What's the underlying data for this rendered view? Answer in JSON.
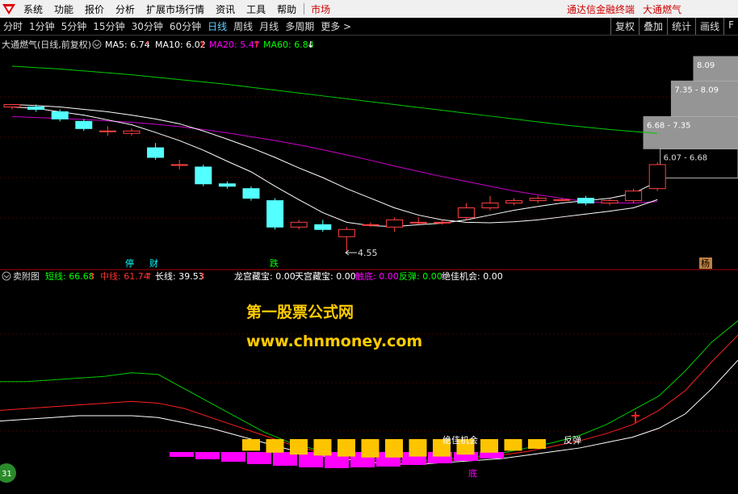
{
  "menu": {
    "items": [
      "系统",
      "功能",
      "报价",
      "分析",
      "扩展市场行情",
      "资讯",
      "工具",
      "帮助"
    ],
    "market": "市场",
    "brand": "通达信金融终端",
    "stock": "大通燃气"
  },
  "periods": [
    "分时",
    "1分钟",
    "5分钟",
    "15分钟",
    "30分钟",
    "60分钟",
    "日线",
    "周线",
    "月线",
    "多周期",
    "更多 >"
  ],
  "active_period": "日线",
  "toolbar_right": [
    "复权",
    "叠加",
    "统计",
    "画线",
    "F"
  ],
  "main_panel": {
    "title": "大通燃气(日线,前复权)",
    "ma": [
      {
        "label": "MA5: 6.74",
        "arrow": "↑",
        "color": "#ffffff"
      },
      {
        "label": "MA10: 6.02",
        "arrow": "↑",
        "color": "#ffffff"
      },
      {
        "label": "MA20: 5.47",
        "arrow": "↑",
        "color": "#ff00ff"
      },
      {
        "label": "MA60: 6.84",
        "arrow": "↓",
        "color": "#00ff00"
      }
    ],
    "low_label": "4.55",
    "price_ranges": [
      "8.09",
      "7.35 - 8.09",
      "6.68 - 7.35",
      "6.07 - 6.68"
    ],
    "markers": [
      "停",
      "财",
      "跌",
      "杨"
    ]
  },
  "sub_panel": {
    "title": "卖附图",
    "fields": [
      {
        "label": "短线: 66.68",
        "arrow": "↑",
        "color": "#00ff00"
      },
      {
        "label": "中线: 61.74",
        "arrow": "↑",
        "color": "#ff3030"
      },
      {
        "label": "长线: 39.53",
        "arrow": "↑",
        "color": "#ffffff"
      },
      {
        "label": "龙宫藏宝: 0.00",
        "arrow": "",
        "color": "#ffffff"
      },
      {
        "label": "天宫藏宝: 0.00",
        "arrow": "",
        "color": "#ffffff"
      },
      {
        "label": "触底: 0.00",
        "arrow": "",
        "color": "#ff00ff"
      },
      {
        "label": "反弹: 0.00",
        "arrow": "",
        "color": "#00ff00"
      },
      {
        "label": "绝佳机会: 0.00",
        "arrow": "",
        "color": "#ffffff"
      }
    ],
    "watermark1": "第一股票公式网",
    "watermark2": "www.chnmoney.com",
    "label_chance": "绝佳机会",
    "label_rebound": "反弹",
    "label_bottom": "底",
    "badge": "31"
  },
  "chart_data": {
    "type": "candlestick",
    "candles": [
      {
        "o": 7.55,
        "c": 7.6,
        "h": 7.6,
        "l": 7.5
      },
      {
        "o": 7.55,
        "c": 7.5,
        "h": 7.6,
        "l": 7.45
      },
      {
        "o": 7.45,
        "c": 7.3,
        "h": 7.5,
        "l": 7.25
      },
      {
        "o": 7.25,
        "c": 7.1,
        "h": 7.3,
        "l": 7.05
      },
      {
        "o": 7.05,
        "c": 7.05,
        "h": 7.15,
        "l": 6.95
      },
      {
        "o": 7.0,
        "c": 7.05,
        "h": 7.1,
        "l": 6.95
      },
      {
        "o": 6.7,
        "c": 6.5,
        "h": 6.8,
        "l": 6.45
      },
      {
        "o": 6.35,
        "c": 6.35,
        "h": 6.45,
        "l": 6.25
      },
      {
        "o": 6.3,
        "c": 5.95,
        "h": 6.35,
        "l": 5.9
      },
      {
        "o": 5.95,
        "c": 5.9,
        "h": 6.0,
        "l": 5.85
      },
      {
        "o": 5.85,
        "c": 5.65,
        "h": 5.9,
        "l": 5.6
      },
      {
        "o": 5.6,
        "c": 5.05,
        "h": 5.65,
        "l": 5.0
      },
      {
        "o": 5.05,
        "c": 5.15,
        "h": 5.2,
        "l": 5.0
      },
      {
        "o": 5.1,
        "c": 5.0,
        "h": 5.2,
        "l": 4.95
      },
      {
        "o": 4.85,
        "c": 5.0,
        "h": 5.05,
        "l": 4.55
      },
      {
        "o": 5.1,
        "c": 5.1,
        "h": 5.15,
        "l": 5.05
      },
      {
        "o": 5.05,
        "c": 5.2,
        "h": 5.25,
        "l": 4.95
      },
      {
        "o": 5.15,
        "c": 5.15,
        "h": 5.25,
        "l": 5.1
      },
      {
        "o": 5.15,
        "c": 5.15,
        "h": 5.2,
        "l": 5.1
      },
      {
        "o": 5.25,
        "c": 5.45,
        "h": 5.55,
        "l": 5.2
      },
      {
        "o": 5.45,
        "c": 5.55,
        "h": 5.7,
        "l": 5.4
      },
      {
        "o": 5.55,
        "c": 5.6,
        "h": 5.65,
        "l": 5.5
      },
      {
        "o": 5.6,
        "c": 5.65,
        "h": 5.7,
        "l": 5.55
      },
      {
        "o": 5.62,
        "c": 5.62,
        "h": 5.65,
        "l": 5.6
      },
      {
        "o": 5.65,
        "c": 5.55,
        "h": 5.7,
        "l": 5.5
      },
      {
        "o": 5.55,
        "c": 5.6,
        "h": 5.65,
        "l": 5.5
      },
      {
        "o": 5.6,
        "c": 5.8,
        "h": 5.85,
        "l": 5.55
      },
      {
        "o": 5.85,
        "c": 6.35,
        "h": 6.4,
        "l": 5.8
      }
    ],
    "ma5": [
      7.55,
      7.52,
      7.45,
      7.38,
      7.28,
      7.18,
      7.02,
      6.85,
      6.65,
      6.42,
      6.2,
      5.9,
      5.62,
      5.35,
      5.15,
      5.08,
      5.06,
      5.1,
      5.13,
      5.2,
      5.3,
      5.4,
      5.48,
      5.55,
      5.6,
      5.65,
      5.75,
      6.0
    ],
    "ma10": [
      7.6,
      7.58,
      7.55,
      7.5,
      7.45,
      7.38,
      7.3,
      7.2,
      7.05,
      6.88,
      6.7,
      6.5,
      6.28,
      6.08,
      5.85,
      5.65,
      5.45,
      5.3,
      5.2,
      5.15,
      5.14,
      5.16,
      5.2,
      5.26,
      5.32,
      5.38,
      5.45,
      5.62
    ],
    "ma20": [
      7.35,
      7.33,
      7.31,
      7.29,
      7.26,
      7.23,
      7.19,
      7.14,
      7.08,
      7.01,
      6.93,
      6.85,
      6.76,
      6.66,
      6.55,
      6.44,
      6.32,
      6.21,
      6.1,
      6.0,
      5.9,
      5.8,
      5.72,
      5.65,
      5.58,
      5.55,
      5.55,
      5.58
    ],
    "ma60": [
      8.4,
      8.37,
      8.34,
      8.3,
      8.26,
      8.22,
      8.17,
      8.12,
      8.07,
      8.02,
      7.96,
      7.9,
      7.84,
      7.78,
      7.72,
      7.66,
      7.6,
      7.54,
      7.48,
      7.42,
      7.36,
      7.3,
      7.24,
      7.18,
      7.13,
      7.08,
      7.04,
      7.0
    ],
    "ylim": [
      4.4,
      8.6
    ],
    "volume_profile": [
      {
        "range": "8.09",
        "width": 0.32
      },
      {
        "range": "7.35 - 8.09",
        "width": 0.48
      },
      {
        "range": "6.68 - 7.35",
        "width": 0.68
      },
      {
        "range": "6.07 - 6.68",
        "width": 0.56
      }
    ],
    "sub": {
      "short": [
        60,
        60,
        61,
        62,
        63,
        65,
        64,
        56,
        48,
        40,
        32,
        26,
        22,
        19,
        17,
        16,
        16,
        17,
        18,
        20,
        23,
        26,
        30,
        36,
        44,
        52,
        66,
        82,
        94
      ],
      "mid": [
        44,
        45,
        46,
        47,
        48,
        49,
        48,
        45,
        40,
        35,
        30,
        25,
        21,
        18,
        16,
        15,
        15,
        16,
        17,
        19,
        21,
        24,
        27,
        31,
        36,
        44,
        55,
        71,
        86
      ],
      "long": [
        38,
        39,
        40,
        41,
        41,
        41,
        40,
        37,
        34,
        30,
        26,
        22,
        19,
        17,
        15,
        14,
        14,
        15,
        16,
        17,
        19,
        21,
        23,
        26,
        29,
        34,
        42,
        56,
        72
      ],
      "bars_yellow": [
        12,
        14,
        16,
        17,
        18,
        19,
        19,
        18,
        18,
        16,
        14,
        12,
        10
      ],
      "bars_magenta": [
        6,
        9,
        12,
        15,
        17,
        19,
        20,
        19,
        18,
        16,
        14,
        11,
        8
      ]
    }
  }
}
